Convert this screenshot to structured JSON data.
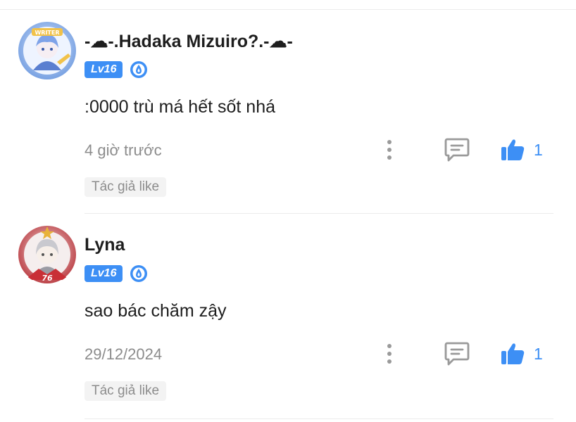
{
  "comments": [
    {
      "username": "-☁-.Hadaka Mizuiro?.-☁-",
      "level": "Lv16",
      "text": ":0000 trù má hết sốt nhá",
      "time": "4 giờ trước",
      "likes": "1",
      "author_tag": "Tác giả like",
      "avatar_badge": "WRITER"
    },
    {
      "username": "Lyna",
      "level": "Lv16",
      "text": "sao bác chăm zậy",
      "time": "29/12/2024",
      "likes": "1",
      "author_tag": "Tác giả like",
      "avatar_badge": "76"
    }
  ],
  "colors": {
    "accent": "#3d8ff5",
    "muted_text": "#8c8c8c",
    "tag_bg": "#f3f3f3"
  },
  "icons": {
    "more": "more-vertical-icon",
    "reply": "comment-icon",
    "like": "thumbs-up-icon",
    "rank": "rank-drop-icon"
  }
}
